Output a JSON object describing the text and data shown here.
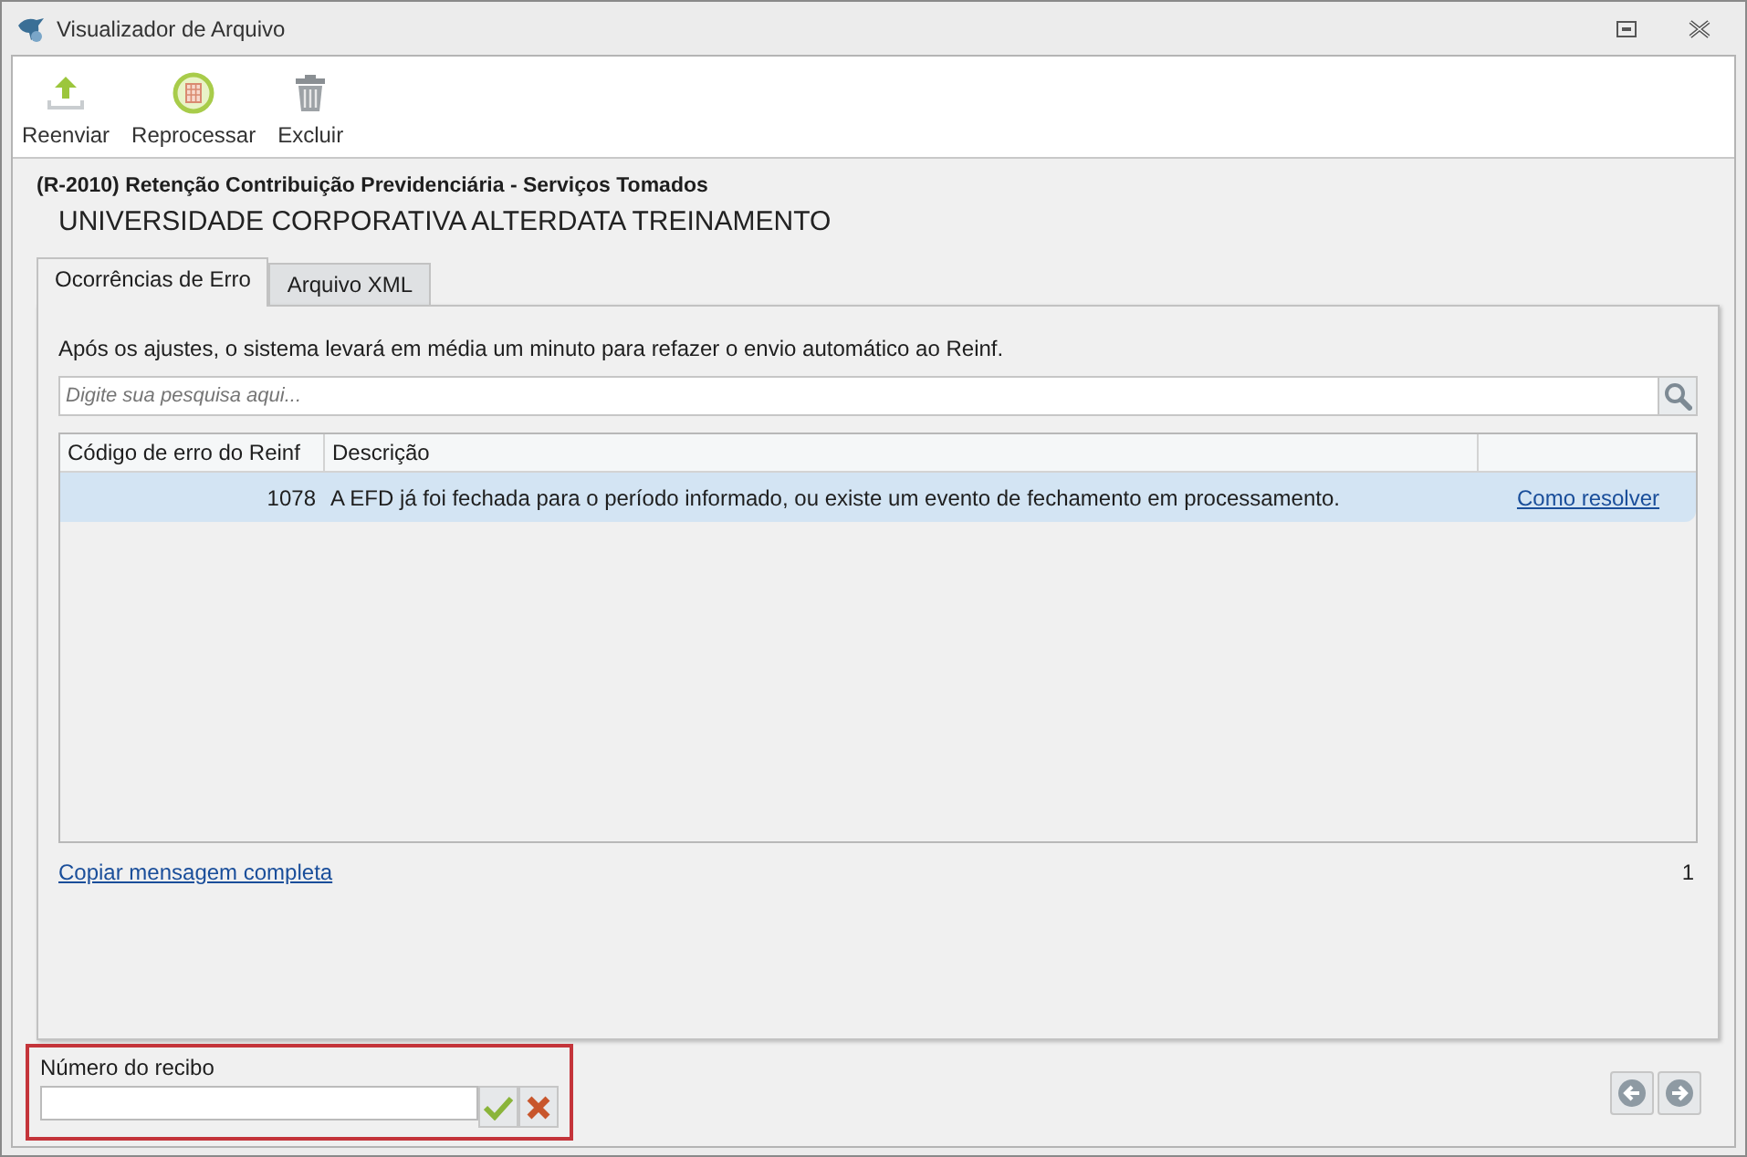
{
  "window": {
    "title": "Visualizador de Arquivo"
  },
  "toolbar": [
    {
      "label": "Reenviar",
      "kind": "upload"
    },
    {
      "label": "Reprocessar",
      "kind": "reprocess"
    },
    {
      "label": "Excluir",
      "kind": "delete"
    }
  ],
  "event_title": "(R-2010) Retenção Contribuição Previdenciária - Serviços Tomados",
  "company": "UNIVERSIDADE CORPORATIVA ALTERDATA TREINAMENTO",
  "tabs": [
    {
      "label": "Ocorrências de Erro",
      "selected": true
    },
    {
      "label": "Arquivo XML",
      "selected": false
    }
  ],
  "info": "Após os ajustes, o sistema levará em média um minuto para refazer o envio automático ao Reinf.",
  "search": {
    "placeholder": "Digite sua pesquisa aqui..."
  },
  "table": {
    "columns": [
      "Código de erro do Reinf",
      "Descrição"
    ],
    "rows": [
      {
        "code": "1078",
        "description": "A EFD já foi fechada para o período informado, ou existe um evento de fechamento em processamento.",
        "link": "Como resolver",
        "selected": true
      }
    ]
  },
  "copy_link": "Copiar mensagem completa",
  "count": "1",
  "receipt": {
    "label": "Número do recibo",
    "highlighted": true
  }
}
